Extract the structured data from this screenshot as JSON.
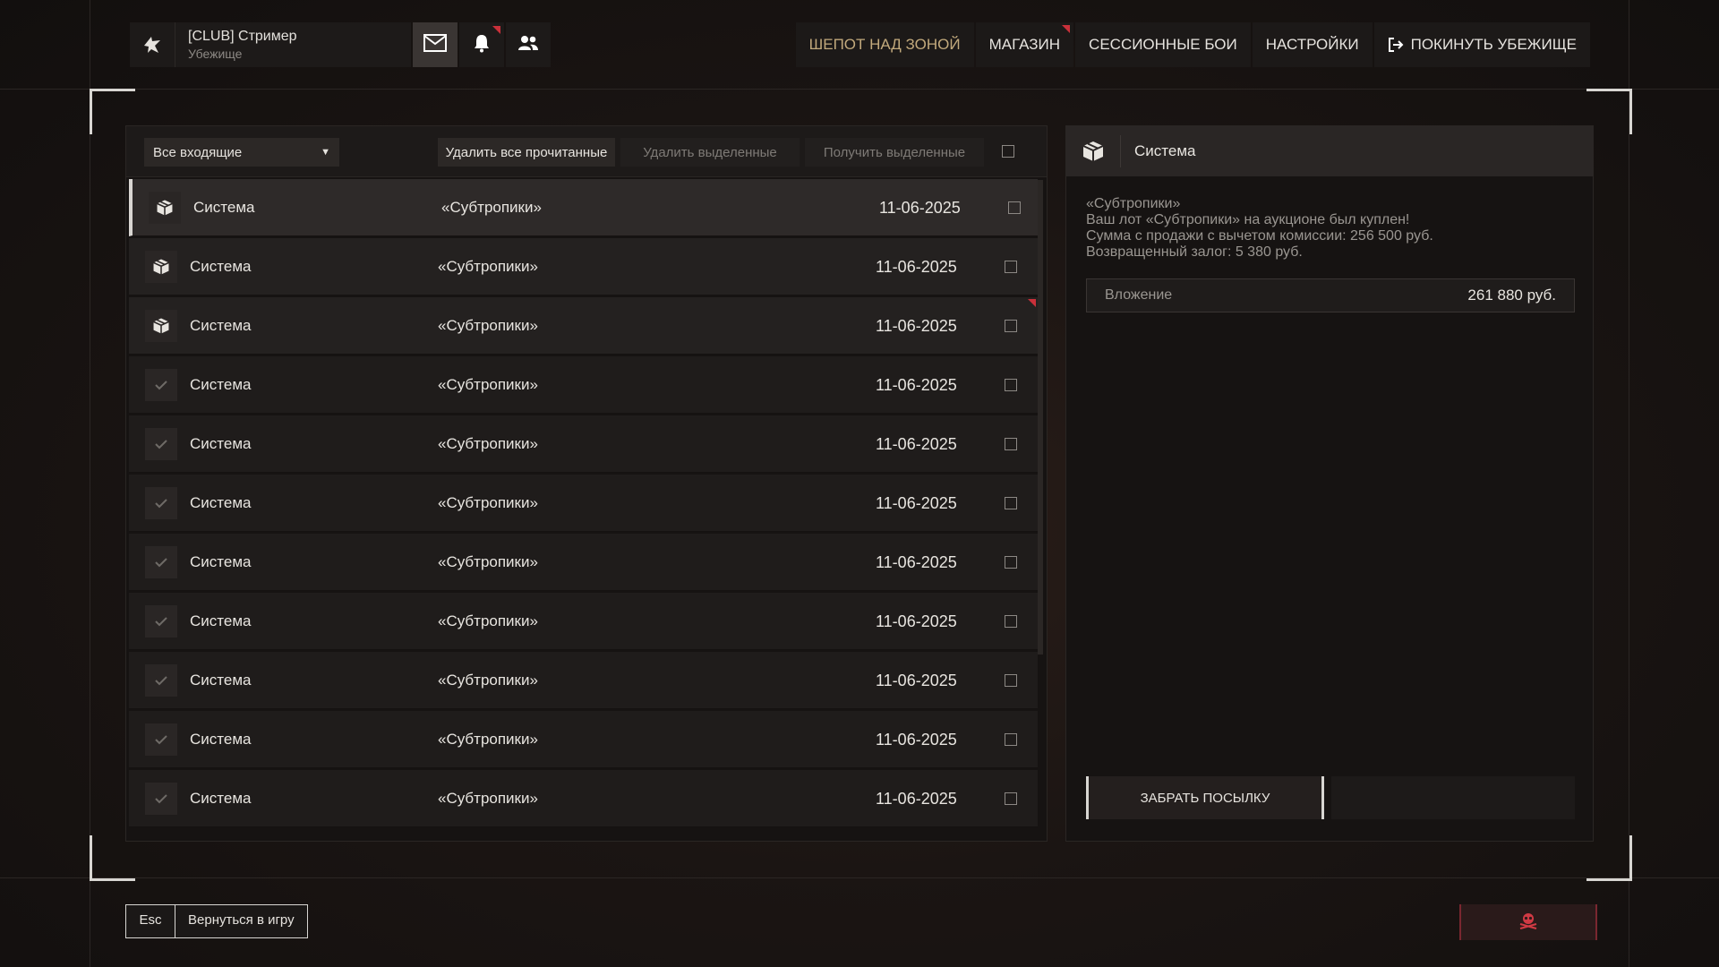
{
  "header": {
    "player_name": "[CLUB] Стример",
    "location": "Убежище",
    "nav": [
      {
        "label": "ШЕПОТ НАД ЗОНОЙ"
      },
      {
        "label": "МАГАЗИН"
      },
      {
        "label": "СЕССИОННЫЕ БОИ"
      },
      {
        "label": "НАСТРОЙКИ"
      },
      {
        "label": "ПОКИНУТЬ УБЕЖИЩЕ"
      }
    ]
  },
  "inbox": {
    "filter_label": "Все входящие",
    "delete_read_label": "Удалить все прочитанные",
    "delete_selected_label": "Удалить выделенные",
    "receive_selected_label": "Получить выделенные",
    "messages": [
      {
        "sender": "Система",
        "subject": "«Субтропики»",
        "date": "11-06-2025",
        "icon": "package-icon",
        "state": "selected"
      },
      {
        "sender": "Система",
        "subject": "«Субтропики»",
        "date": "11-06-2025",
        "icon": "package-icon",
        "state": "unread"
      },
      {
        "sender": "Система",
        "subject": "«Субтропики»",
        "date": "11-06-2025",
        "icon": "package-icon",
        "state": "unread"
      },
      {
        "sender": "Система",
        "subject": "«Субтропики»",
        "date": "11-06-2025",
        "icon": "check-icon",
        "state": "read"
      },
      {
        "sender": "Система",
        "subject": "«Субтропики»",
        "date": "11-06-2025",
        "icon": "check-icon",
        "state": "read"
      },
      {
        "sender": "Система",
        "subject": "«Субтропики»",
        "date": "11-06-2025",
        "icon": "check-icon",
        "state": "read"
      },
      {
        "sender": "Система",
        "subject": "«Субтропики»",
        "date": "11-06-2025",
        "icon": "check-icon",
        "state": "read"
      },
      {
        "sender": "Система",
        "subject": "«Субтропики»",
        "date": "11-06-2025",
        "icon": "check-icon",
        "state": "read"
      },
      {
        "sender": "Система",
        "subject": "«Субтропики»",
        "date": "11-06-2025",
        "icon": "check-icon",
        "state": "read"
      },
      {
        "sender": "Система",
        "subject": "«Субтропики»",
        "date": "11-06-2025",
        "icon": "check-icon",
        "state": "read"
      },
      {
        "sender": "Система",
        "subject": "«Субтропики»",
        "date": "11-06-2025",
        "icon": "check-icon",
        "state": "read"
      }
    ]
  },
  "detail": {
    "sender": "Система",
    "body_lines": [
      "«Субтропики»",
      "Ваш лот «Субтропики» на аукционе был куплен!",
      "Сумма с продажи с вычетом комиссии: 256 500 руб.",
      "Возвращенный залог: 5 380 руб."
    ],
    "attachment_label": "Вложение",
    "attachment_value": "261 880 руб.",
    "claim_label": "ЗАБРАТЬ ПОСЫЛКУ"
  },
  "footer": {
    "esc_key": "Esc",
    "esc_action": "Вернуться в игру"
  },
  "colors": {
    "accent_gold": "#c2a97c",
    "notify_red": "#c9303a",
    "background": "#1b1513"
  }
}
